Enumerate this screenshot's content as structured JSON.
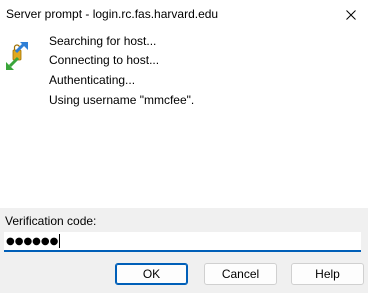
{
  "window": {
    "title": "Server prompt - login.rc.fas.harvard.edu",
    "close_icon": "close-icon"
  },
  "log": {
    "icon": "transfer-arrows-key-icon",
    "lines": [
      "Searching for host...",
      "Connecting to host...",
      "Authenticating...",
      "Using username \"mmcfee\"."
    ]
  },
  "prompt": {
    "label": "Verification code:",
    "value": "●●●●●●"
  },
  "buttons": {
    "ok": "OK",
    "cancel": "Cancel",
    "help": "Help"
  },
  "colors": {
    "accent": "#005fb8",
    "arrow_blue": "#2f7fd6",
    "arrow_green": "#3aa53a",
    "lock_gold": "#e0a820"
  }
}
